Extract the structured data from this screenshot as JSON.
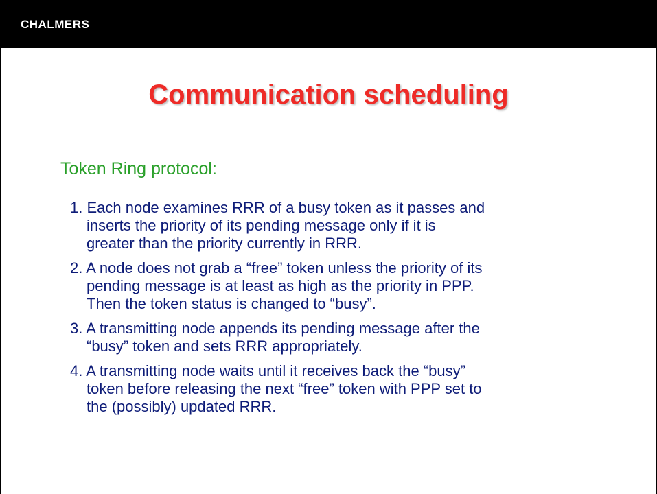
{
  "header": {
    "logo_text": "CHALMERS"
  },
  "slide": {
    "title": "Communication scheduling",
    "subtitle": "Token Ring protocol:",
    "steps": [
      {
        "lines": [
          "1. Each node examines RRR of a busy token as it passes and",
          "inserts the priority of its pending message only if it is",
          "greater than the priority currently in RRR."
        ]
      },
      {
        "lines": [
          "2. A node does not grab a “free” token unless the priority of its",
          "pending message is at least as high as the priority in PPP.",
          "Then the token status is changed to “busy”."
        ]
      },
      {
        "lines": [
          "3. A transmitting node appends its pending message after the",
          "“busy” token and sets RRR appropriately."
        ]
      },
      {
        "lines": [
          "4. A transmitting node waits until it receives back the “busy”",
          "token before releasing the next “free” token with PPP set to",
          "the (possibly) updated RRR."
        ]
      }
    ]
  },
  "colors": {
    "title": "#ee2b27",
    "subtitle": "#2aa02a",
    "body_text": "#0e1c78",
    "header_bg": "#000000"
  }
}
